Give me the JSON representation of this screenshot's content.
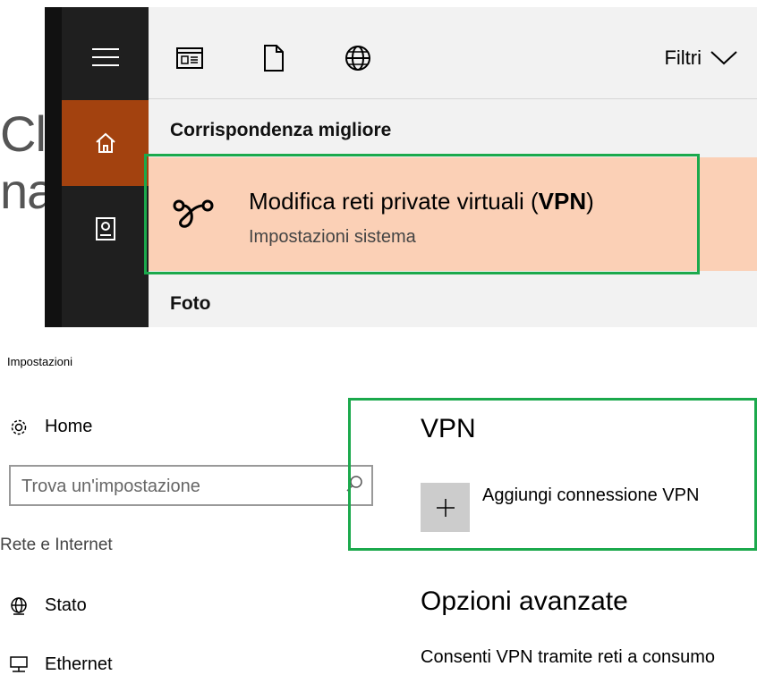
{
  "background_text": [
    "Clic",
    "na"
  ],
  "search_flyout": {
    "rail": [
      {
        "icon": "hamburger-menu-icon"
      },
      {
        "icon": "home-icon",
        "active": true
      },
      {
        "icon": "notebook-icon"
      }
    ],
    "top_icons": [
      "app-window-icon",
      "document-icon",
      "web-globe-icon"
    ],
    "filters_label": "Filtri",
    "best_match_heading": "Corrispondenza migliore",
    "best_match": {
      "title_prefix": "Modifica reti private virtuali (",
      "title_bold": "VPN",
      "title_suffix": ")",
      "subtitle": "Impostazioni sistema",
      "icon": "vpn-icon"
    },
    "photos_heading": "Foto"
  },
  "settings": {
    "window_title": "Impostazioni",
    "home_label": "Home",
    "search_placeholder": "Trova un'impostazione",
    "group_label": "Rete e Internet",
    "nav_items": [
      {
        "label": "Stato",
        "icon": "network-globe-icon"
      },
      {
        "label": "Ethernet",
        "icon": "ethernet-icon"
      }
    ],
    "vpn_heading": "VPN",
    "add_vpn_label": "Aggiungi connessione VPN",
    "advanced_heading": "Opzioni avanzate",
    "advanced_option_1": "Consenti VPN tramite reti a consumo"
  },
  "colors": {
    "highlight": "#1ba94c",
    "accent_rail": "#a3420f",
    "best_match_bg": "#fbd0b6"
  }
}
